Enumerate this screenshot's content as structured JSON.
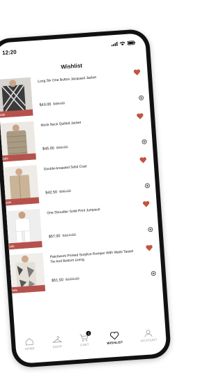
{
  "status_bar": {
    "time": "12:20"
  },
  "header": {
    "title": "Wishlist"
  },
  "colors": {
    "accent": "#b6524d",
    "heart": "#c2553f"
  },
  "items": [
    {
      "name": "Long Slv One Button Jacquard Jacket",
      "price": "$43.00",
      "original_price": "$86.00",
      "sale_label": "Sale"
    },
    {
      "name": "Mock Neck Quilted Jacket",
      "price": "$45.00",
      "original_price": "$90.00",
      "sale_label": "Sale"
    },
    {
      "name": "Double-breasted Solid Coat",
      "price": "$42.50",
      "original_price": "$85.00",
      "sale_label": "Sale"
    },
    {
      "name": "One Shoulder Solid Print Jumpsuit",
      "price": "$57.00",
      "original_price": "$114.00",
      "sale_label": "Sale"
    },
    {
      "name": "Patchwork Printed Surplice Romper With Waist Tassel Tie And Bottom Lining",
      "price": "$51.50",
      "original_price": "$103.00",
      "sale_label": "Sale"
    }
  ],
  "tabs": [
    {
      "label": "HOME",
      "icon": "home-icon"
    },
    {
      "label": "SHOP",
      "icon": "hanger-icon"
    },
    {
      "label": "CART",
      "icon": "cart-icon",
      "badge": "1"
    },
    {
      "label": "WISHLIST",
      "icon": "heart-icon",
      "active": true
    },
    {
      "label": "ACCOUNT",
      "icon": "user-icon"
    }
  ]
}
